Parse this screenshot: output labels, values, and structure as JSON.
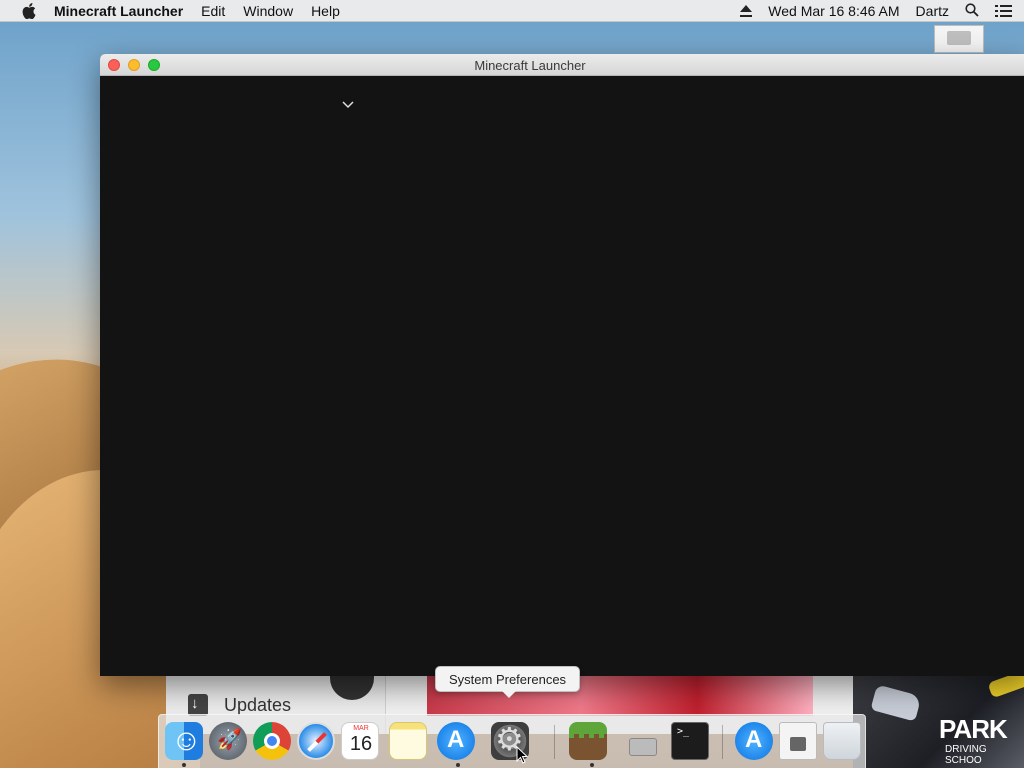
{
  "menubar": {
    "app_name": "Minecraft Launcher",
    "menus": [
      "Edit",
      "Window",
      "Help"
    ],
    "datetime": "Wed Mar 16  8:46 AM",
    "user": "Dartz"
  },
  "window": {
    "title": "Minecraft Launcher"
  },
  "tooltip": {
    "text": "System Preferences"
  },
  "background_app": {
    "sidebar_item": "Updates"
  },
  "background_image": {
    "brand": "PARK",
    "subtitle": "DRIVING SCHOO"
  },
  "dock": {
    "calendar_month": "MAR",
    "calendar_day": "16",
    "items": [
      "Finder",
      "Launchpad",
      "Google Chrome",
      "Safari",
      "Calendar",
      "Notes",
      "App Store",
      "System Preferences",
      "Minecraft",
      "Printer",
      "Terminal",
      "Downloads",
      "Documents",
      "Trash"
    ]
  },
  "colors": {
    "window_bg": "#131313",
    "close": "#fc5f57",
    "minimize": "#fdbb2e",
    "maximize": "#28c840"
  }
}
